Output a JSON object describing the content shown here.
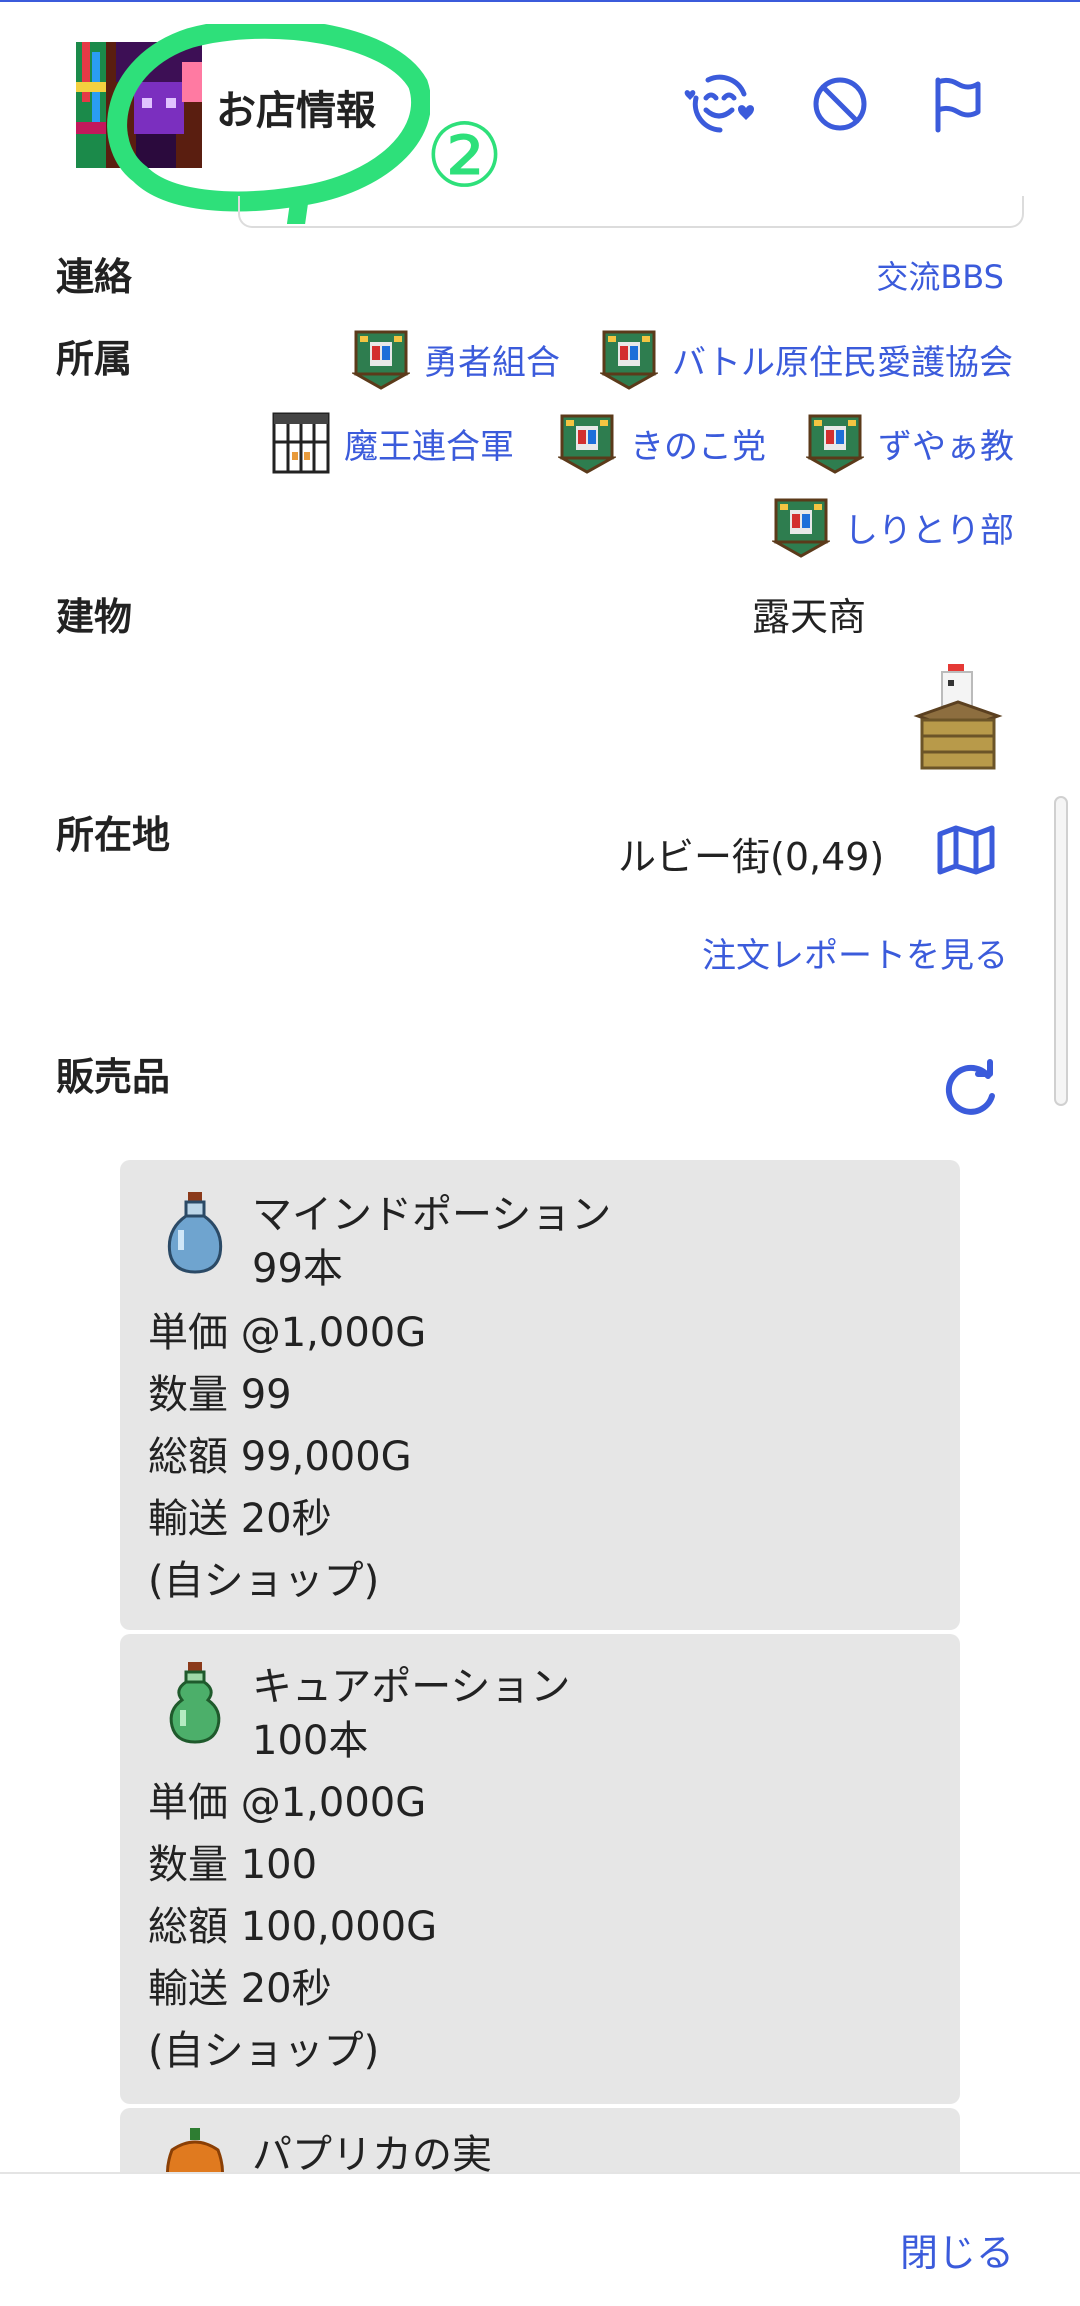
{
  "header": {
    "title": "お店情報",
    "annotation_number": "②",
    "icons": [
      "smile-icon",
      "block-icon",
      "flag-icon"
    ]
  },
  "contact": {
    "label": "連絡",
    "link": "交流BBS"
  },
  "affiliation": {
    "label": "所属",
    "orgs": [
      "勇者組合",
      "バトル原住民愛護協会",
      "魔王連合軍",
      "きのこ党",
      "ずやぁ教",
      "しりとり部"
    ]
  },
  "building": {
    "label": "建物",
    "value": "露天商"
  },
  "location": {
    "label": "所在地",
    "value": "ルビー街(0,49)",
    "report_link": "注文レポートを見る"
  },
  "products": {
    "label": "販売品",
    "items": [
      {
        "name": "マインドポーション",
        "stock": "99本",
        "price": "単価 @1,000G",
        "quantity": "数量 99",
        "total": "総額 99,000G",
        "shipping": "輸送 20秒",
        "note": "(自ショップ)"
      },
      {
        "name": "キュアポーション",
        "stock": "100本",
        "price": "単価 @1,000G",
        "quantity": "数量 100",
        "total": "総額 100,000G",
        "shipping": "輸送 20秒",
        "note": "(自ショップ)"
      },
      {
        "name": "パプリカの実"
      }
    ]
  },
  "footer": {
    "close": "閉じる"
  },
  "colors": {
    "link": "#3b5bdb",
    "annotation": "#2ee07a",
    "card": "#e6e6e6"
  }
}
